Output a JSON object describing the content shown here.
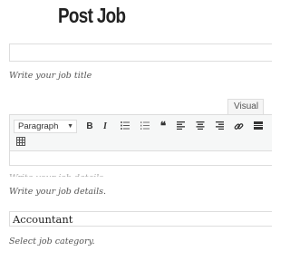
{
  "page": {
    "title": "Post Job"
  },
  "job_title": {
    "value": "",
    "help_text": "Write your job title"
  },
  "editor": {
    "active_tab": "Visual",
    "format_select": "Paragraph",
    "toolbar_buttons": {
      "bold": "B",
      "italic": "I",
      "blockquote": "❝"
    },
    "content": "",
    "ghost_text": "Write your job details.",
    "help_text": "Write your job details."
  },
  "category": {
    "selected": "Accountant",
    "help_text": "Select job category."
  },
  "colors": {
    "border": "#dddddd",
    "toolbar_bg": "#f6f7f7",
    "icon": "#333333"
  }
}
